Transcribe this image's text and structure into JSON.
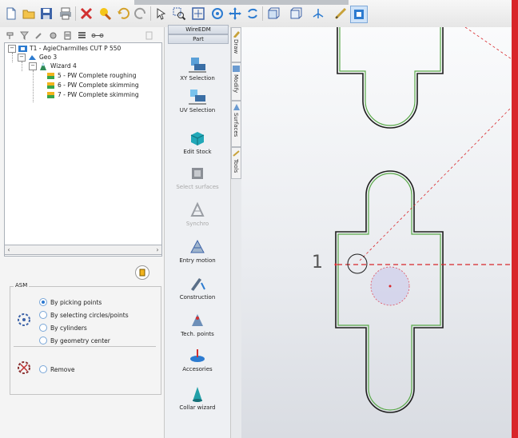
{
  "toolbar": {
    "icons": [
      "new-file-icon",
      "open-folder-icon",
      "save-icon",
      "print-icon",
      "delete-icon",
      "highlight-icon",
      "undo-icon",
      "redo-icon",
      "select-icon",
      "zoom-window-icon",
      "zoom-fit-icon",
      "rotate-icon",
      "pan-icon",
      "refresh-icon",
      "view-box-icon",
      "view-options-icon",
      "axis-icon",
      "measure-icon",
      "active-view-icon"
    ]
  },
  "tree": {
    "root": "T1 - AgieCharmilles CUT P 550",
    "geo": "Geo 3",
    "wizard": "Wizard 4",
    "ops": [
      "5 - PW Complete roughing",
      "6 - PW Complete skimming",
      "7 - PW Complete skimming"
    ]
  },
  "asm": {
    "legend": "ASM",
    "options": [
      "By picking points",
      "By selecting circles/points",
      "By cylinders",
      "By geometry center"
    ],
    "selected_index": 0,
    "remove_label": "Remove"
  },
  "palette": {
    "header1": "WireEDM",
    "header2": "Part",
    "items": [
      {
        "label": "XY Selection",
        "enabled": true
      },
      {
        "label": "UV Selection",
        "enabled": true
      },
      {
        "label": "Edit Stock",
        "enabled": true
      },
      {
        "label": "Select surfaces",
        "enabled": false
      },
      {
        "label": "Synchro",
        "enabled": false
      },
      {
        "label": "Entry motion",
        "enabled": true
      },
      {
        "label": "Construction",
        "enabled": true
      },
      {
        "label": "Tech. points",
        "enabled": true
      },
      {
        "label": "Accesories",
        "enabled": true
      },
      {
        "label": "Collar wizard",
        "enabled": true
      }
    ]
  },
  "sidetabs": [
    "Draw",
    "Modify",
    "Surfaces",
    "Tools"
  ],
  "viewport": {
    "start_label": "1",
    "accent": "#d8262a"
  }
}
